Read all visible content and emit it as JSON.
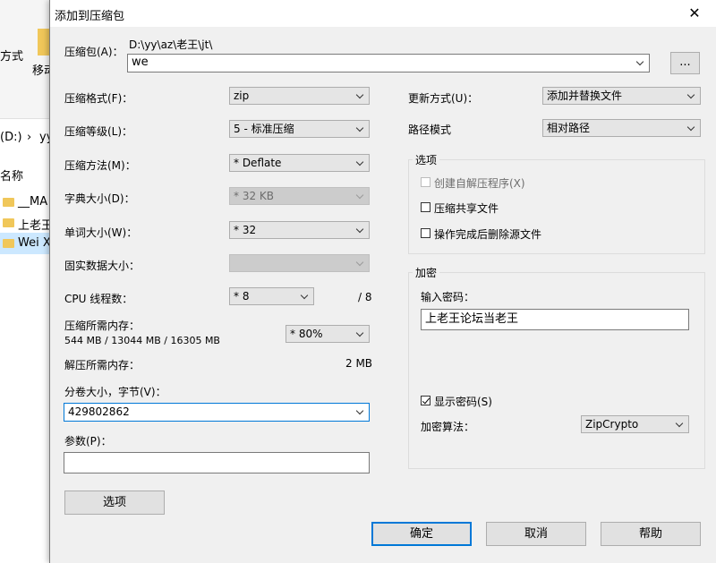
{
  "background": {
    "ribbon_text_1": "方式",
    "ribbon_text_2": "移动",
    "drive": "(D:)",
    "drive_arrow": "›",
    "drive_next": "yy",
    "name_header": "名称",
    "files": [
      "__MA",
      "上老王",
      "Wei X"
    ]
  },
  "dialog": {
    "title": "添加到压缩包",
    "close": "✕",
    "archive": {
      "label": "压缩包(A)：",
      "path": "D:\\yy\\az\\老王\\jt\\",
      "value": "we",
      "browse": "..."
    },
    "left": {
      "format_label": "压缩格式(F)：",
      "format_value": "zip",
      "level_label": "压缩等级(L)：",
      "level_value": "5 - 标准压缩",
      "method_label": "压缩方法(M)：",
      "method_value": "* Deflate",
      "dict_label": "字典大小(D)：",
      "dict_value": "* 32 KB",
      "word_label": "单词大小(W)：",
      "word_value": "* 32",
      "solid_label": "固实数据大小：",
      "solid_value": "",
      "cpu_label": "CPU 线程数：",
      "cpu_value": "* 8",
      "cpu_total": "/ 8",
      "mem_label": "压缩所需内存：",
      "mem_info": "544 MB / 13044 MB / 16305 MB",
      "mem_value": "* 80%",
      "decomp_label": "解压所需内存：",
      "decomp_value": "2 MB",
      "split_label": "分卷大小，字节(V)：",
      "split_value": "429802862",
      "params_label": "参数(P)：",
      "params_value": "",
      "options_button": "选项"
    },
    "right": {
      "update_label": "更新方式(U)：",
      "update_value": "添加并替换文件",
      "path_label": "路径模式",
      "path_value": "相对路径",
      "options_title": "选项",
      "opt_sfx": "创建自解压程序(X)",
      "opt_shared": "压缩共享文件",
      "opt_delete": "操作完成后删除源文件",
      "encrypt_title": "加密",
      "password_label": "输入密码：",
      "password_value": "上老王论坛当老王",
      "show_password": "显示密码(S)",
      "algo_label": "加密算法：",
      "algo_value": "ZipCrypto"
    },
    "buttons": {
      "ok": "确定",
      "cancel": "取消",
      "help": "帮助"
    }
  },
  "colors": {
    "accent": "#0078d7",
    "dialog_bg": "#f0f0f0",
    "folder": "#f0c75a"
  }
}
